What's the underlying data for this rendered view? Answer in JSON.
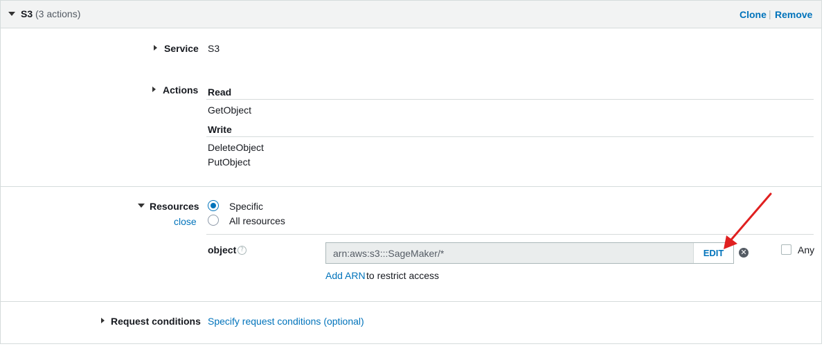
{
  "header": {
    "title": "S3",
    "count": "(3 actions)",
    "clone_label": "Clone",
    "separator": "|",
    "remove_label": "Remove"
  },
  "service": {
    "label": "Service",
    "value": "S3"
  },
  "actions": {
    "label": "Actions",
    "groups": [
      {
        "title": "Read",
        "items": [
          "GetObject"
        ]
      },
      {
        "title": "Write",
        "items": [
          "DeleteObject",
          "PutObject"
        ]
      }
    ]
  },
  "resources": {
    "label": "Resources",
    "close_label": "close",
    "options": [
      {
        "label": "Specific",
        "selected": true
      },
      {
        "label": "All resources",
        "selected": false
      }
    ],
    "object_label": "object",
    "help_icon": "?",
    "arn_value": "arn:aws:s3:::SageMaker/*",
    "edit_label": "EDIT",
    "clear_icon": "✕",
    "any_label": "Any",
    "add_arn_label": "Add ARN",
    "add_arn_suffix": "to restrict access"
  },
  "request_conditions": {
    "label": "Request conditions",
    "link_label": "Specify request conditions (optional)"
  },
  "colors": {
    "link": "#0073bb",
    "annotation_arrow": "#e02020",
    "header_bg": "#f2f3f3"
  }
}
